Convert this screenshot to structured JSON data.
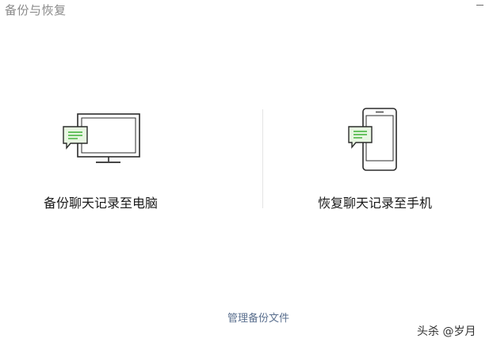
{
  "window": {
    "title": "备份与恢复"
  },
  "options": [
    {
      "label": "备份聊天记录至电脑",
      "icon": "monitor-chat-icon"
    },
    {
      "label": "恢复聊天记录至手机",
      "icon": "phone-chat-icon"
    }
  ],
  "footer": {
    "manage_label": "管理备份文件"
  },
  "watermark": {
    "text": "头杀 @岁月"
  },
  "colors": {
    "chat_bubble_fill": "#e8f6e2",
    "chat_bubble_stroke": "#2b2b2b",
    "chat_line_green": "#3cb034",
    "link": "#5a6f8e",
    "title": "#8a8a8a"
  }
}
